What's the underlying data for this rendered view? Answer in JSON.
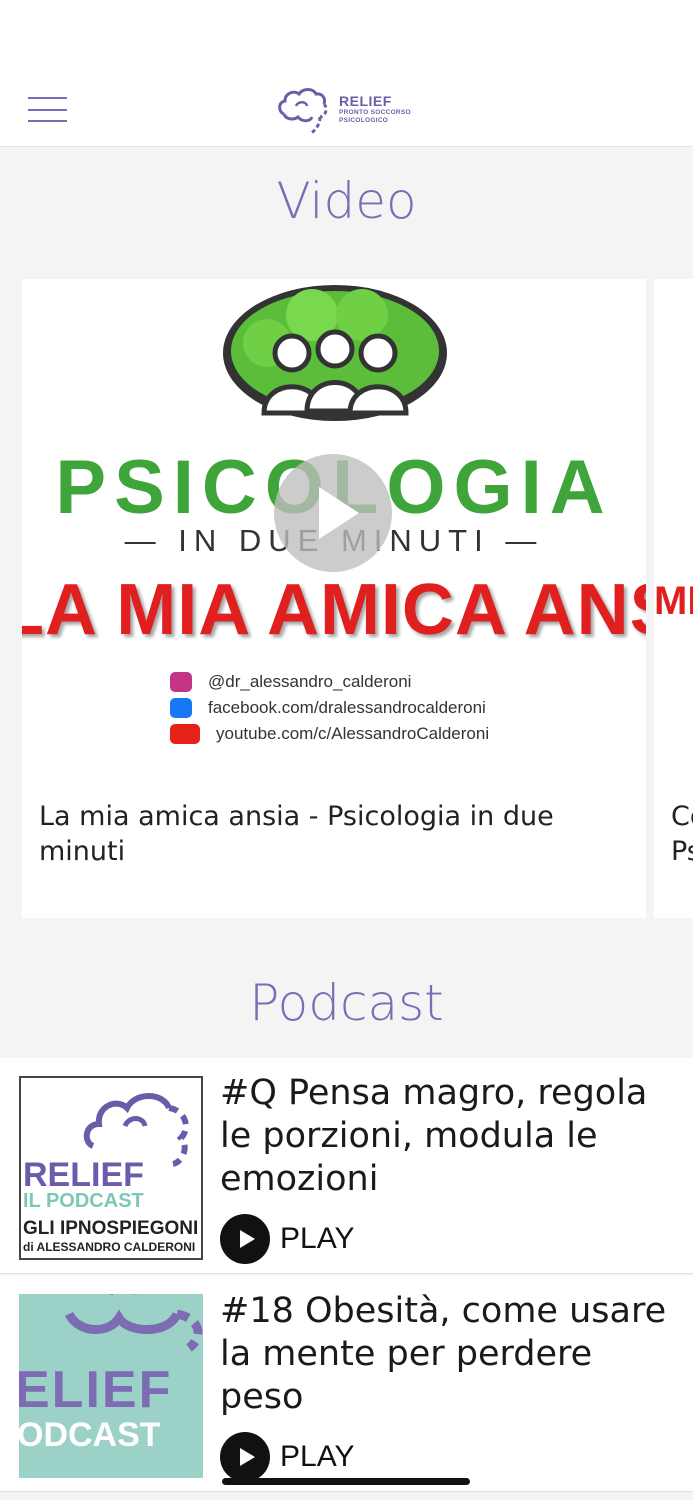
{
  "header": {
    "menu_icon": "hamburger-menu-icon",
    "logo": {
      "title": "RELIEF",
      "subtitle_line1": "PRONTO SOCCORSO",
      "subtitle_line2": "PSICOLOGICO"
    }
  },
  "video_section": {
    "title": "Video",
    "cards": [
      {
        "thumbnail": {
          "word1": "PSICOLOGIA",
          "word2": "— IN DUE MINUTI —",
          "headline": "LA MIA AMICA ANSIA",
          "socials": [
            {
              "icon": "instagram-icon",
              "color": "#c13584",
              "text": "@dr_alessandro_calderoni"
            },
            {
              "icon": "facebook-icon",
              "color": "#1877f2",
              "text": "facebook.com/dralessandrocalderoni"
            },
            {
              "icon": "youtube-icon",
              "color": "#e62117",
              "text": "youtube.com/c/AlessandroCalderoni"
            }
          ]
        },
        "caption": "La mia amica ansia - Psicologia in due minuti"
      },
      {
        "thumbnail": {
          "headline": "ME"
        },
        "caption": "Co\nPs"
      }
    ]
  },
  "podcast_section": {
    "title": "Podcast",
    "items": [
      {
        "thumb": {
          "line1": "RELIEF",
          "line2": "IL PODCAST",
          "line3": "GLI IPNOSPIEGONI",
          "line4": "di ALESSANDRO CALDERONI"
        },
        "title": "#Q Pensa magro, regola le porzioni, modula le emozioni",
        "play_label": "PLAY"
      },
      {
        "thumb": {
          "line1": "ELIEF",
          "line2": "ODCAST"
        },
        "title": "#18 Obesità, come usare la mente per perdere peso",
        "play_label": "PLAY"
      }
    ]
  },
  "colors": {
    "accent": "#7d6cb4",
    "psico_green": "#3fa43a",
    "ansia_red": "#e01f1f",
    "podcast_teal": "#9bd1c6"
  }
}
